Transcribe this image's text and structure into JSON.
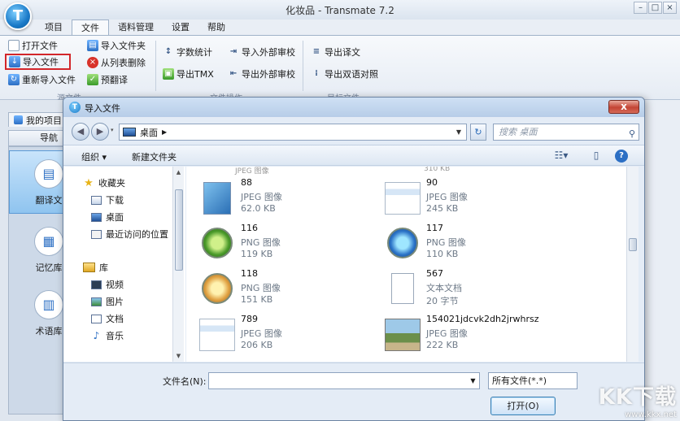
{
  "app": {
    "title": "化妆品 - Transmate 7.2",
    "logo_letter": "T"
  },
  "menu": {
    "tabs": [
      "项目",
      "文件",
      "语料管理",
      "设置",
      "帮助"
    ]
  },
  "ribbon": {
    "open_file": "打开文件",
    "import_file": "导入文件",
    "reimport_file": "重新导入文件",
    "import_folder": "导入文件夹",
    "remove_from_list": "从列表删除",
    "pretranslate": "预翻译",
    "word_count": "字数统计",
    "export_tmx": "导出TMX",
    "import_external_review": "导入外部审校",
    "export_external_review": "导出外部审校",
    "export_translation": "导出译文",
    "export_bilingual": "导出双语对照",
    "group_source": "源文件",
    "group_file_ops": "文件操作",
    "group_target": "目标文件"
  },
  "left": {
    "project_tab": "我的项目",
    "nav_header": "导航",
    "nav_items": [
      "翻译文",
      "记忆库",
      "术语库"
    ]
  },
  "dialog": {
    "title": "导入文件",
    "close_label": "x",
    "location": "桌面",
    "search_placeholder": "搜索 桌面",
    "organize": "组织 ▾",
    "new_folder": "新建文件夹",
    "tree": {
      "favorites": "收藏夹",
      "downloads": "下载",
      "desktop": "桌面",
      "recent": "最近访问的位置",
      "libraries": "库",
      "videos": "视频",
      "pictures": "图片",
      "documents": "文档",
      "music": "音乐"
    },
    "clipped_top_left": "JPEG 图像",
    "clipped_top_right": "310 KB",
    "files": [
      {
        "name": "88",
        "type": "JPEG 图像",
        "size": "62.0 KB",
        "thumb": "blue"
      },
      {
        "name": "90",
        "type": "JPEG 图像",
        "size": "245 KB",
        "thumb": "jpg"
      },
      {
        "name": "116",
        "type": "PNG 图像",
        "size": "119 KB",
        "thumb": "green"
      },
      {
        "name": "117",
        "type": "PNG 图像",
        "size": "110 KB",
        "thumb": "ocean"
      },
      {
        "name": "118",
        "type": "PNG 图像",
        "size": "151 KB",
        "thumb": "amber"
      },
      {
        "name": "567",
        "type": "文本文档",
        "size": "20 字节",
        "thumb": "txt"
      },
      {
        "name": "789",
        "type": "JPEG 图像",
        "size": "206 KB",
        "thumb": "jpg"
      },
      {
        "name": "154021jdcvk2dh2jrwhrsz",
        "type": "JPEG 图像",
        "size": "222 KB",
        "thumb": "photo"
      }
    ],
    "filename_label": "文件名(N):",
    "filename_value": "",
    "filetype": "所有文件(*.*)",
    "open_button": "打开(O)"
  },
  "watermark": {
    "big": "KK下载",
    "small": "www.kkx.net"
  }
}
